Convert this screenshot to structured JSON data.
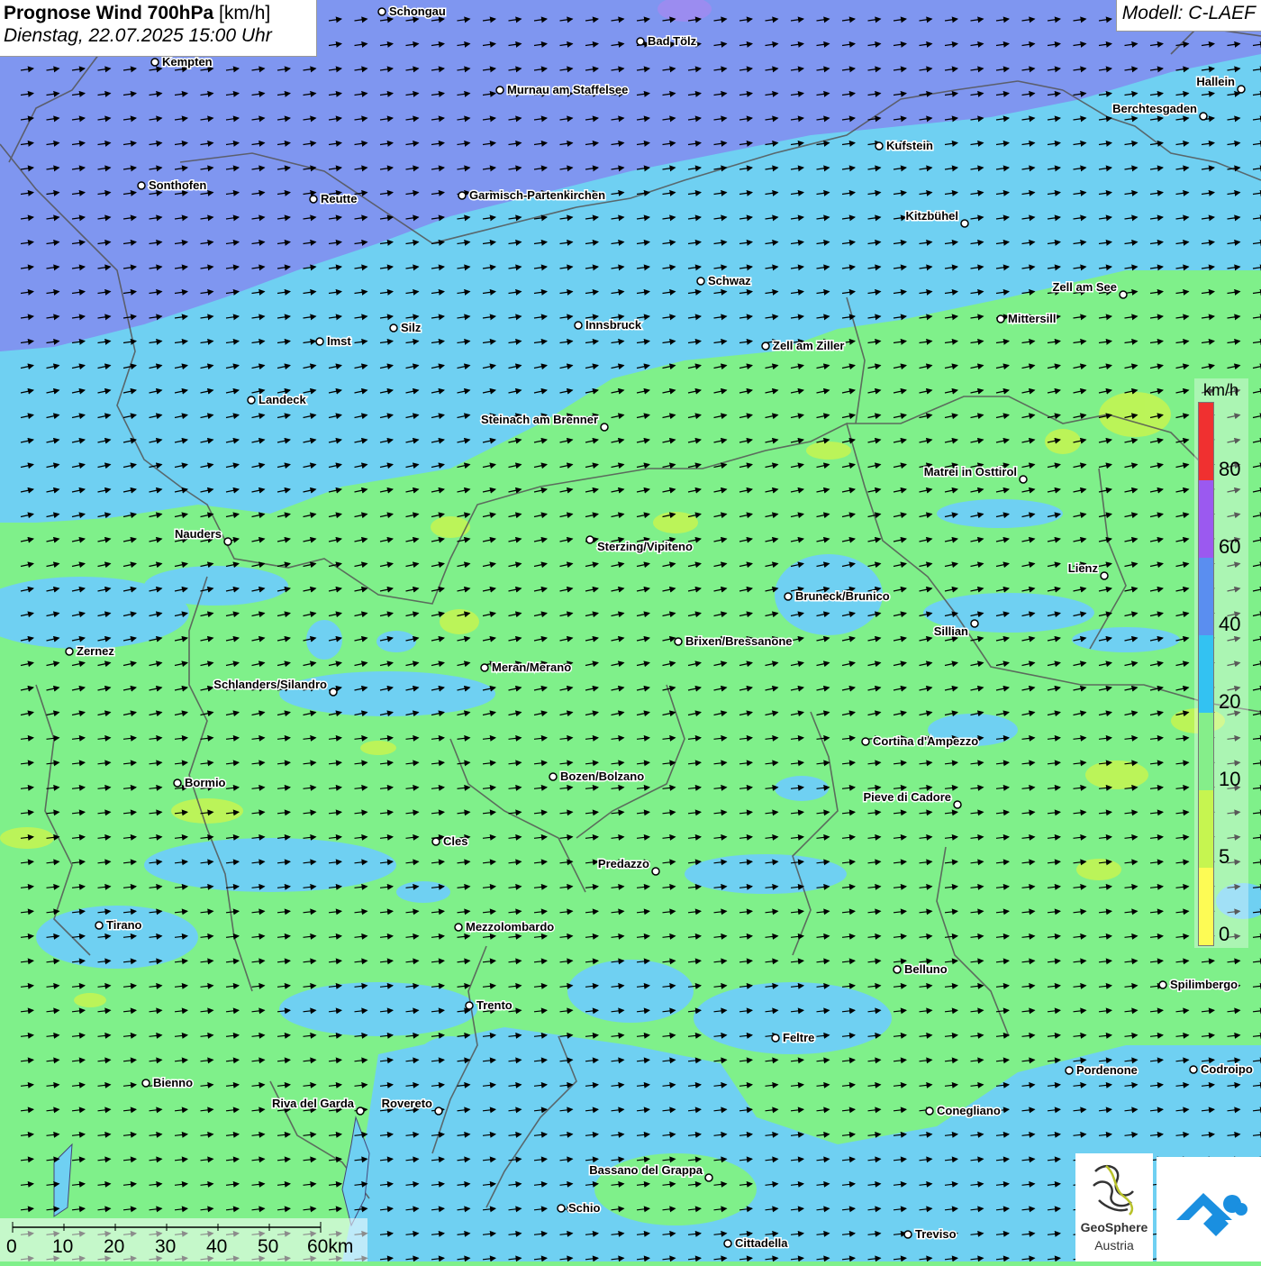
{
  "header": {
    "title_bold": "Prognose Wind 700hPa",
    "title_unit": "[km/h]",
    "subtitle": "Dienstag, 22.07.2025 15:00 Uhr"
  },
  "model_label": "Modell: C-LAEF",
  "legend": {
    "unit": "km/h",
    "labels": [
      "80",
      "60",
      "40",
      "20",
      "10",
      "5",
      "0"
    ],
    "colors": [
      "#f03030",
      "#9b59f0",
      "#5a8ef0",
      "#33c2f2",
      "#85ee8a",
      "#c6f550",
      "#fdfb55"
    ]
  },
  "scale_bar": {
    "labels": [
      "0",
      "10",
      "20",
      "30",
      "40",
      "50",
      "60km"
    ]
  },
  "logos": {
    "geosphere_name": "GeoSphere",
    "geosphere_sub": "Austria"
  },
  "colors": {
    "high": "#7f96f0",
    "mid": "#6fd0f2",
    "low": "#7ff08a"
  },
  "cities": [
    "Schongau",
    "Bad Tölz",
    "Kempten",
    "Murnau am Staffelsee",
    "Hallein",
    "Berchtesgaden",
    "Kufstein",
    "Sonthofen",
    "Reutte",
    "Garmisch-Partenkirchen",
    "Kitzbühel",
    "Schwaz",
    "Zell am See",
    "Mittersill",
    "Innsbruck",
    "Silz",
    "Imst",
    "Zell am Ziller",
    "Landeck",
    "Steinach am Brenner",
    "Matrei in Osttirol",
    "Nauders",
    "Sterzing/Vipiteno",
    "Lienz",
    "Bruneck/Brunico",
    "Sillian",
    "Zernez",
    "Brixen/Bressanone",
    "Meran/Merano",
    "Schlanders/Silandro",
    "Cortina d'Ampezzo",
    "Bozen/Bolzano",
    "Bormio",
    "Pieve di Cadore",
    "Cles",
    "Predazzo",
    "Tirano",
    "Mezzolombardo",
    "Belluno",
    "Spilimbergo",
    "Trento",
    "Feltre",
    "Pordenone",
    "Codroipo",
    "Bienno",
    "Riva del Garda",
    "Rovereto",
    "Conegliano",
    "Bassano del Grappa",
    "Schio",
    "Treviso",
    "Cittadella"
  ]
}
